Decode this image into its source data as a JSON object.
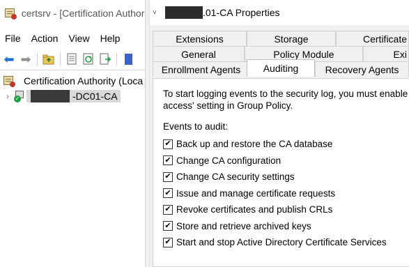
{
  "left_window": {
    "title": "certsrv - [Certification Authori",
    "menu": [
      "File",
      "Action",
      "View",
      "Help"
    ],
    "toolbar_icons": [
      "back-arrow-icon",
      "forward-arrow-icon",
      "up-folder-icon",
      "properties-icon",
      "refresh-icon",
      "export-list-icon",
      "help-icon"
    ],
    "tree": {
      "root_label": "Certification Authority (Loca",
      "node_label": "-DC01-CA",
      "node_expander": "›"
    }
  },
  "dialog": {
    "title": ".01-CA Properties",
    "tabs_row1": [
      "Extensions",
      "Storage",
      "Certificate M"
    ],
    "tabs_row2": [
      "General",
      "Policy Module",
      "Exi"
    ],
    "tabs_row3": [
      "Enrollment Agents",
      "Auditing",
      "Recovery Agents"
    ],
    "active_tab": "Auditing",
    "intro_line1": "To start logging events to the security log, you must enable the",
    "intro_line2": "access' setting in Group Policy.",
    "events_label": "Events to audit:",
    "events": [
      {
        "label": "Back up and restore the CA database",
        "checked": true
      },
      {
        "label": "Change CA configuration",
        "checked": true
      },
      {
        "label": "Change CA security settings",
        "checked": true
      },
      {
        "label": "Issue and manage certificate requests",
        "checked": true
      },
      {
        "label": "Revoke certificates and publish CRLs",
        "checked": true
      },
      {
        "label": "Store and retrieve archived keys",
        "checked": true
      },
      {
        "label": "Start and stop Active Directory Certificate Services",
        "checked": true
      }
    ]
  },
  "colors": {
    "selection": "#d9d9d9",
    "dialog_bg": "#f0f0f0",
    "accent_blue": "#1f6fd1"
  }
}
